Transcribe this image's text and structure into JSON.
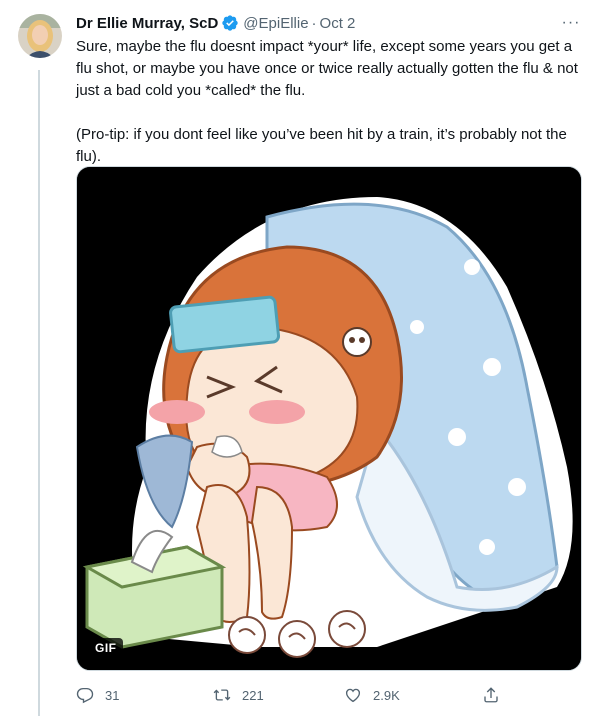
{
  "tweet": {
    "author": {
      "display_name": "Dr Ellie Murray, ScD",
      "handle": "@EpiEllie",
      "verified": true,
      "avatar_icon": "user-avatar"
    },
    "separator": "·",
    "timestamp": "Oct 2",
    "more_label": "···",
    "text_paragraphs": [
      "Sure, maybe the flu doesnt impact *your* life, except some years you get a flu shot, or maybe you have once or twice really actually gotten the flu & not just a bad cold you *called* the flu.",
      "(Pro-tip: if you dont feel like you’ve been hit by a train, it’s probably not the flu)."
    ],
    "media": {
      "type": "gif",
      "badge": "GIF"
    },
    "actions": {
      "reply_count": "31",
      "retweet_count": "221",
      "like_count": "2.9K"
    }
  },
  "colors": {
    "text": "#0f1419",
    "secondary": "#536471",
    "verified": "#1d9bf0",
    "thread_line": "#cfd9de"
  }
}
